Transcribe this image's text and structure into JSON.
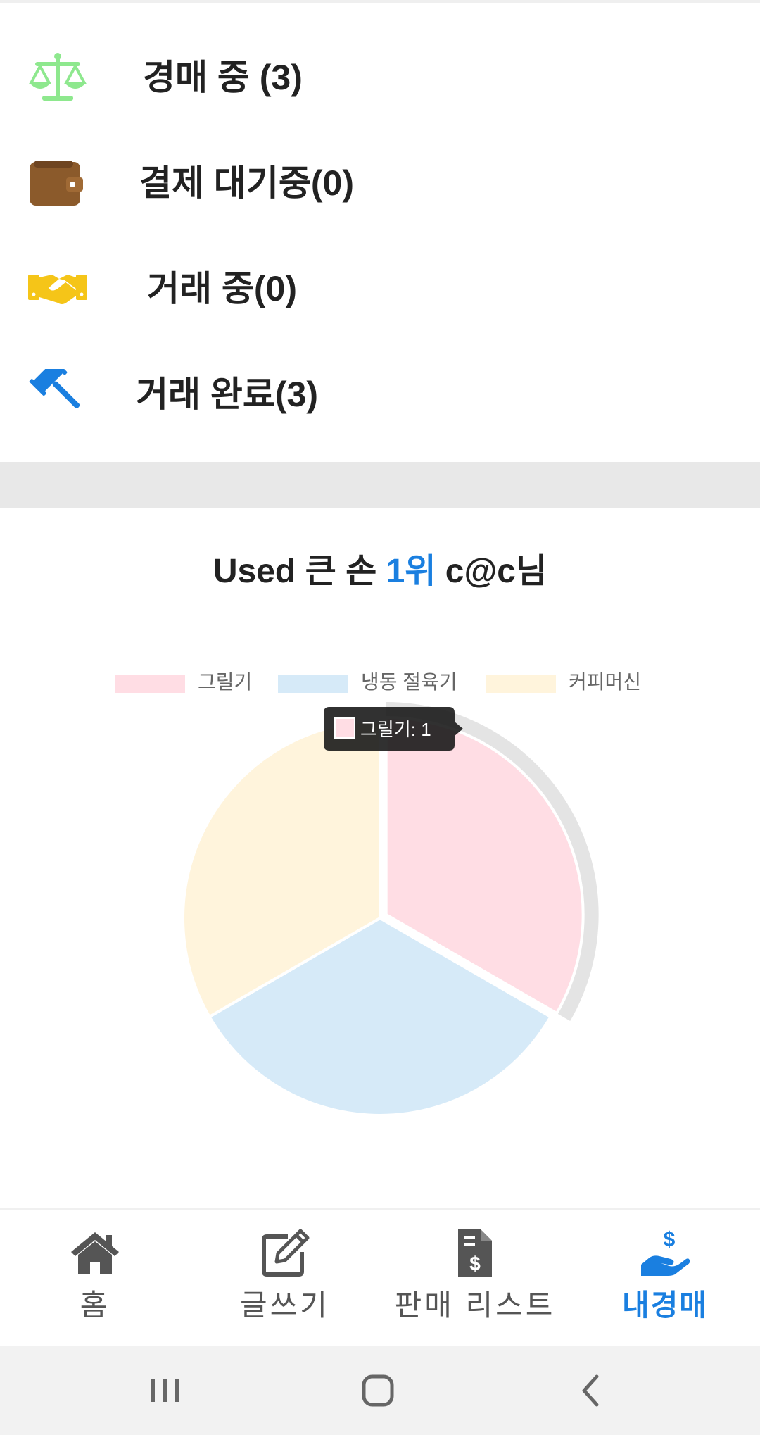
{
  "status_items": [
    {
      "label": "경매 중 (3)",
      "icon": "scale-icon",
      "color": "#8ee88e"
    },
    {
      "label": "결제 대기중(0)",
      "icon": "wallet-icon",
      "color": "#8b5a2b"
    },
    {
      "label": "거래 중(0)",
      "icon": "handshake-icon",
      "color": "#f5c518"
    },
    {
      "label": "거래 완료(3)",
      "icon": "gavel-icon",
      "color": "#1a7fe0"
    }
  ],
  "chart_header": {
    "prefix": "Used 큰 손",
    "rank": "1위",
    "suffix": "c@c님",
    "rank_color": "#1a7fe0"
  },
  "chart_data": {
    "type": "pie",
    "categories": [
      "그릴기",
      "냉동 절육기",
      "커피머신"
    ],
    "values": [
      1,
      1,
      1
    ],
    "colors": [
      "#ffdde4",
      "#d6eaf8",
      "#fff4dc"
    ],
    "legend_position": "top",
    "highlighted": "그릴기",
    "tooltip": "그릴기: 1"
  },
  "bottom_nav": [
    {
      "label": "홈",
      "icon": "home-icon",
      "active": false
    },
    {
      "label": "글쓰기",
      "icon": "edit-icon",
      "active": false
    },
    {
      "label": "판매 리스트",
      "icon": "invoice-dollar-icon",
      "active": false
    },
    {
      "label": "내경매",
      "icon": "hand-dollar-icon",
      "active": true
    }
  ],
  "colors": {
    "active": "#1a7fe0",
    "inactive": "#555555"
  },
  "system_nav": [
    "recent-apps-icon",
    "home-button-icon",
    "back-icon"
  ]
}
